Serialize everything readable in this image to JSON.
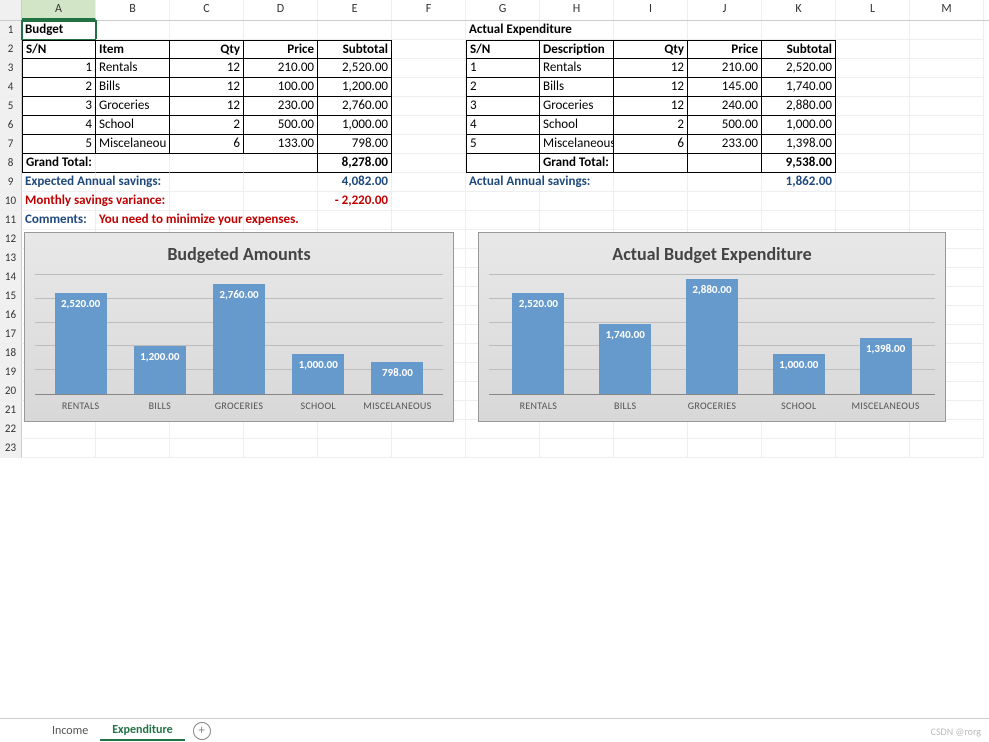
{
  "columns": [
    "A",
    "B",
    "C",
    "D",
    "E",
    "F",
    "G",
    "H",
    "I",
    "J",
    "K",
    "L",
    "M"
  ],
  "rowCount": 23,
  "activeCell": "A1",
  "budget": {
    "title": "Budget",
    "headers": {
      "sn": "S/N",
      "item": "Item",
      "qty": "Qty",
      "price": "Price",
      "subtotal": "Subtotal"
    },
    "rows": [
      {
        "sn": "1",
        "item": "Rentals",
        "qty": "12",
        "price": "210.00",
        "subtotal": "2,520.00"
      },
      {
        "sn": "2",
        "item": "Bills",
        "qty": "12",
        "price": "100.00",
        "subtotal": "1,200.00"
      },
      {
        "sn": "3",
        "item": "Groceries",
        "qty": "12",
        "price": "230.00",
        "subtotal": "2,760.00"
      },
      {
        "sn": "4",
        "item": "School",
        "qty": "2",
        "price": "500.00",
        "subtotal": "1,000.00"
      },
      {
        "sn": "5",
        "item": "Miscelaneou",
        "qty": "6",
        "price": "133.00",
        "subtotal": "798.00"
      }
    ],
    "grand_label": "Grand Total:",
    "grand_value": "8,278.00"
  },
  "actual": {
    "title": "Actual Expenditure",
    "headers": {
      "sn": "S/N",
      "item": "Description",
      "qty": "Qty",
      "price": "Price",
      "subtotal": "Subtotal"
    },
    "rows": [
      {
        "sn": "1",
        "item": "Rentals",
        "qty": "12",
        "price": "210.00",
        "subtotal": "2,520.00"
      },
      {
        "sn": "2",
        "item": "Bills",
        "qty": "12",
        "price": "145.00",
        "subtotal": "1,740.00"
      },
      {
        "sn": "3",
        "item": "Groceries",
        "qty": "12",
        "price": "240.00",
        "subtotal": "2,880.00"
      },
      {
        "sn": "4",
        "item": "School",
        "qty": "2",
        "price": "500.00",
        "subtotal": "1,000.00"
      },
      {
        "sn": "5",
        "item": "Miscelaneous",
        "qty": "6",
        "price": "233.00",
        "subtotal": "1,398.00"
      }
    ],
    "grand_label": "Grand Total:",
    "grand_value": "9,538.00"
  },
  "summary": {
    "exp_label": "Expected Annual savings:",
    "exp_value": "4,082.00",
    "act_label": "Actual Annual savings:",
    "act_value": "1,862.00",
    "var_label": "Monthly savings variance:",
    "var_value": "- 2,220.00",
    "comments_label": "Comments:",
    "comments_value": "You need to minimize your expenses."
  },
  "tabs": {
    "income": "Income",
    "expenditure": "Expenditure"
  },
  "watermark": "CSDN @rorg",
  "chart_data": [
    {
      "type": "bar",
      "title": "Budgeted Amounts",
      "categories": [
        "RENTALS",
        "BILLS",
        "GROCERIES",
        "SCHOOL",
        "MISCELANEOUS"
      ],
      "values": [
        2520.0,
        1200.0,
        2760.0,
        1000.0,
        798.0
      ],
      "labels": [
        "2,520.00",
        "1,200.00",
        "2,760.00",
        "1,000.00",
        "798.00"
      ],
      "ylim": [
        0,
        3000
      ]
    },
    {
      "type": "bar",
      "title": "Actual Budget Expenditure",
      "categories": [
        "RENTALS",
        "BILLS",
        "GROCERIES",
        "SCHOOL",
        "MISCELANEOUS"
      ],
      "values": [
        2520.0,
        1740.0,
        2880.0,
        1000.0,
        1398.0
      ],
      "labels": [
        "2,520.00",
        "1,740.00",
        "2,880.00",
        "1,000.00",
        "1,398.00"
      ],
      "ylim": [
        0,
        3000
      ]
    }
  ]
}
